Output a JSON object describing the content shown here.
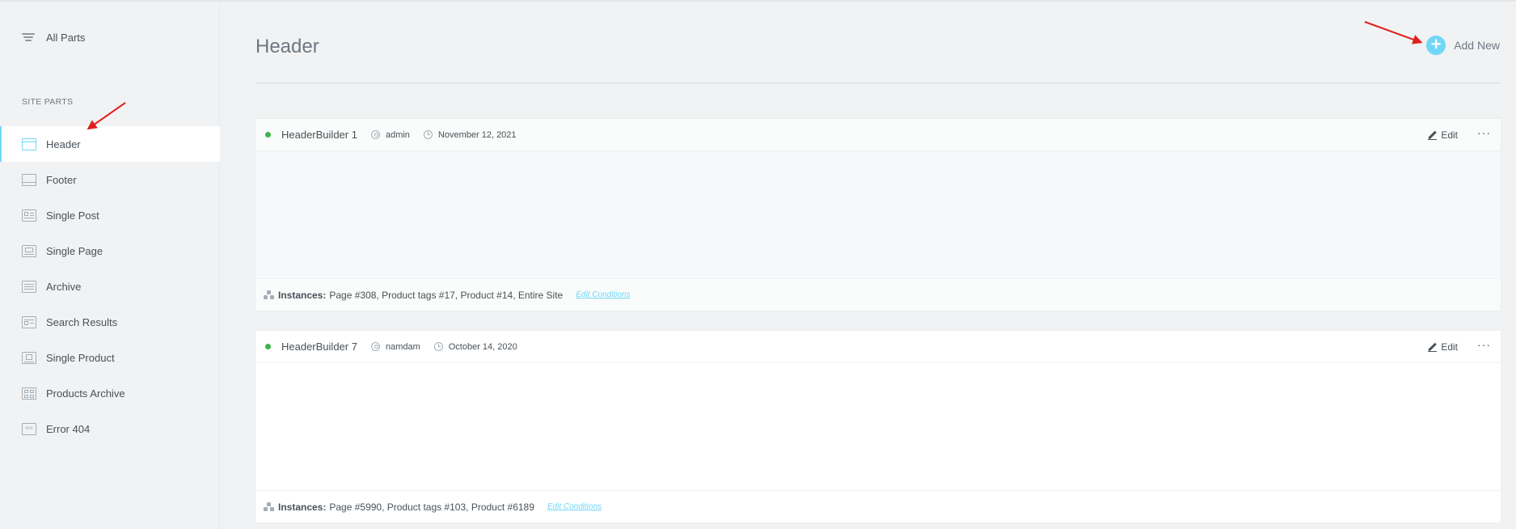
{
  "sidebar": {
    "all_parts_label": "All Parts",
    "section_title": "SITE PARTS",
    "items": [
      {
        "label": "Header",
        "icon": "header-layout-icon",
        "active": true
      },
      {
        "label": "Footer",
        "icon": "footer-layout-icon"
      },
      {
        "label": "Single Post",
        "icon": "single-post-icon"
      },
      {
        "label": "Single Page",
        "icon": "single-page-icon"
      },
      {
        "label": "Archive",
        "icon": "archive-icon"
      },
      {
        "label": "Search Results",
        "icon": "search-results-icon"
      },
      {
        "label": "Single Product",
        "icon": "single-product-icon"
      },
      {
        "label": "Products Archive",
        "icon": "products-archive-icon"
      },
      {
        "label": "Error 404",
        "icon": "error-404-icon",
        "icon_text": "404"
      }
    ]
  },
  "main": {
    "title": "Header",
    "add_new_label": "Add New",
    "add_new_icon": "plus-circle-icon",
    "cards": [
      {
        "title": "HeaderBuilder 1",
        "author": "admin",
        "date": "November 12, 2021",
        "edit_label": "Edit",
        "instances_label": "Instances:",
        "instances": "Page #308, Product tags #17, Product #14, Entire Site",
        "edit_conditions_label": "Edit Conditions"
      },
      {
        "title": "HeaderBuilder 7",
        "author": "namdam",
        "date": "October 14, 2020",
        "edit_label": "Edit",
        "instances_label": "Instances:",
        "instances": "Page #5990, Product tags #103, Product #6189",
        "edit_conditions_label": "Edit Conditions"
      }
    ]
  },
  "colors": {
    "accent": "#71d7f7",
    "status_published": "#39b54a",
    "annotation_arrow": "#e0201c"
  }
}
